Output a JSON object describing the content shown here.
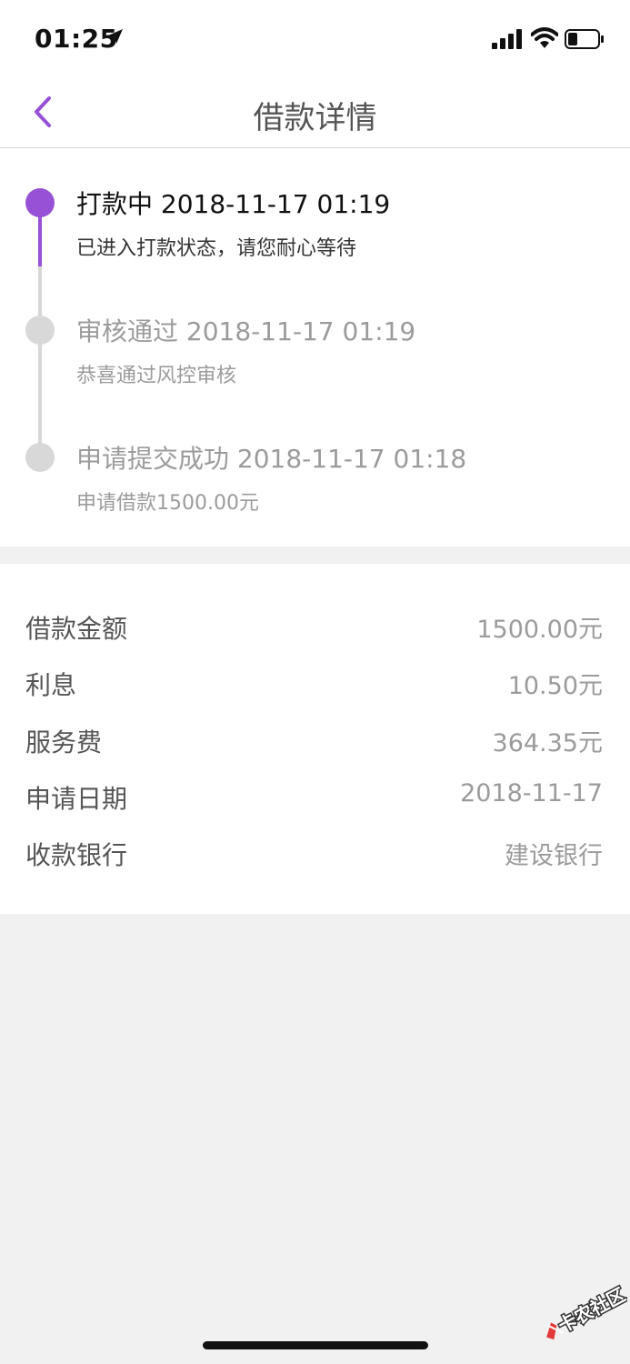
{
  "status_bar": {
    "time": "01:25"
  },
  "header": {
    "title": "借款详情"
  },
  "timeline": [
    {
      "title": "打款中 2018-11-17 01:19",
      "desc": "已进入打款状态，请您耐心等待",
      "active": true
    },
    {
      "title": "审核通过 2018-11-17 01:19",
      "desc": "恭喜通过风控审核",
      "active": false
    },
    {
      "title": "申请提交成功 2018-11-17 01:18",
      "desc": "申请借款1500.00元",
      "active": false
    }
  ],
  "details": [
    {
      "label": "借款金额",
      "value": "1500.00元"
    },
    {
      "label": "利息",
      "value": "10.50元"
    },
    {
      "label": "服务费",
      "value": "364.35元"
    },
    {
      "label": "申请日期",
      "value": "2018-11-17"
    },
    {
      "label": "收款银行",
      "value": "建设银行"
    }
  ],
  "watermark": {
    "text": "卡农社区"
  },
  "colors": {
    "accent": "#9751d6",
    "inactive": "#d8d8d8",
    "background": "#f1f1f1"
  }
}
